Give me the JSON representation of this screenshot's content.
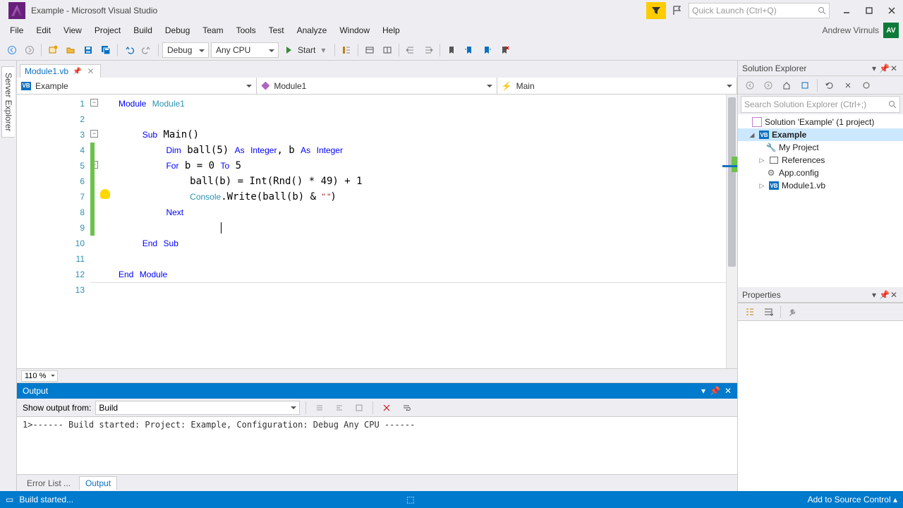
{
  "window": {
    "title": "Example - Microsoft Visual Studio"
  },
  "quicklaunch": {
    "placeholder": "Quick Launch (Ctrl+Q)"
  },
  "user": {
    "name": "Andrew Virnuls",
    "initials": "AV"
  },
  "menus": [
    "File",
    "Edit",
    "View",
    "Project",
    "Build",
    "Debug",
    "Team",
    "Tools",
    "Test",
    "Analyze",
    "Window",
    "Help"
  ],
  "toolbar": {
    "config": "Debug",
    "platform": "Any CPU",
    "start": "Start"
  },
  "doc_tab": {
    "label": "Module1.vb"
  },
  "navbar": {
    "project": "Example",
    "type": "Module1",
    "member": "Main"
  },
  "zoom": "110 %",
  "code": {
    "lines": [
      "1",
      "2",
      "3",
      "4",
      "5",
      "6",
      "7",
      "8",
      "9",
      "10",
      "11",
      "12",
      "13"
    ]
  },
  "solution": {
    "header": "Solution Explorer",
    "search_placeholder": "Search Solution Explorer (Ctrl+;)",
    "root": "Solution 'Example' (1 project)",
    "project": "Example",
    "nodes": [
      "My Project",
      "References",
      "App.config",
      "Module1.vb"
    ]
  },
  "properties": {
    "header": "Properties"
  },
  "output": {
    "header": "Output",
    "show_from_label": "Show output from:",
    "show_from_value": "Build",
    "text": "1>------ Build started: Project: Example, Configuration: Debug Any CPU ------"
  },
  "bottom_tabs": {
    "errors": "Error List ...",
    "output": "Output"
  },
  "status": {
    "left": "Build started...",
    "right": "Add to Source Control"
  },
  "side_tab": "Server Explorer"
}
